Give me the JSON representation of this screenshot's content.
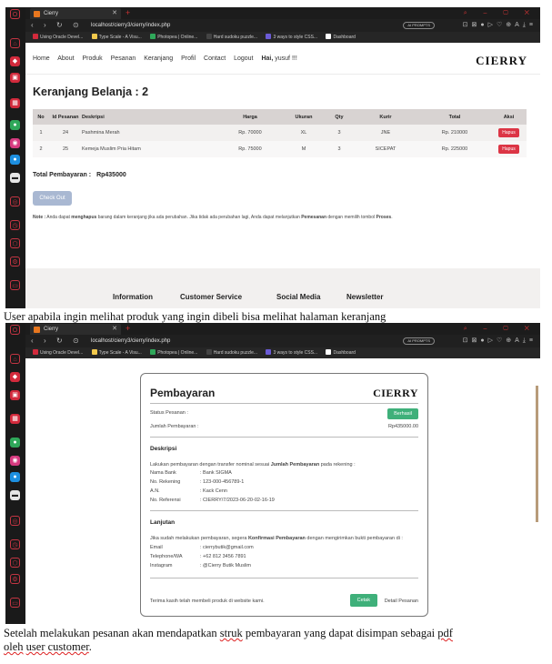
{
  "browser": {
    "tab_title": "Cierry",
    "url": "localhost/cierry3/cierry/index.php",
    "ai_pill": "AI PROMPTS",
    "bookmarks": [
      "Using Oracle Devel...",
      "Type Scale - A Visu...",
      "Photopea | Online...",
      "Hard sudoku puzzle...",
      "3 ways to style CSS...",
      "Dashboard"
    ],
    "bookmark_colors": [
      "#d22a3c",
      "#f2c94c",
      "#2fa85a",
      "#444444",
      "#6b5bd6",
      "#ffffff"
    ]
  },
  "cart_page": {
    "nav": [
      "Home",
      "About",
      "Produk",
      "Pesanan",
      "Keranjang",
      "Profil",
      "Contact",
      "Logout"
    ],
    "greeting": "Hai,",
    "user": "yusuf !!!",
    "brand": "CIERRY",
    "title": "Keranjang Belanja : 2",
    "columns": [
      "No",
      "Id Pesanan",
      "Deskripsi",
      "Harga",
      "Ukuran",
      "Qty",
      "Kurir",
      "Total",
      "Aksi"
    ],
    "rows": [
      [
        "1",
        "24",
        "Pashmina Merah",
        "Rp. 70000",
        "XL",
        "3",
        "JNE",
        "Rp. 210000",
        "Hapus"
      ],
      [
        "2",
        "25",
        "Kemeja Muslim Pria Hitam",
        "Rp. 75000",
        "M",
        "3",
        "SICEPAT",
        "Rp. 225000",
        "Hapus"
      ]
    ],
    "total_label": "Total Pembayaran :",
    "total_value": "Rp435000",
    "checkout": "Check Out",
    "note_label": "Note :",
    "note_text_1": " Anda dapat ",
    "note_bold_1": "menghapus",
    "note_text_2": " barang dalam keranjang jika ada perubahan. Jika tidak ada perubahan lagi, Anda dapat melanjutkan ",
    "note_bold_2": "Pemesanan",
    "note_text_3": " dengan memilih tombol ",
    "note_bold_3": "Proses",
    "note_text_4": ".",
    "footer_links": [
      "Information",
      "Customer Service",
      "Social Media",
      "Newsletter"
    ]
  },
  "caption1": "User apabila ingin melihat produk yang ingin dibeli bisa melihat halaman keranjang",
  "receipt": {
    "title": "Pembayaran",
    "brand": "CIERRY",
    "status_label": "Status Pesanan :",
    "status_value": "Berhasil",
    "amount_label": "Jumlah Pembayaran :",
    "amount_value": "Rp435000.00",
    "desc_head": "Deskripsi",
    "desc_text_1": "Lakukan pembayaran dengan transfer nominal sesuai ",
    "desc_bold": "Jumlah Pembayaran",
    "desc_text_2": " pada rekening :",
    "bank_rows": [
      [
        "Nama Bank",
        ": Bank SIGMA"
      ],
      [
        "No. Rekening",
        ": 123-000-456789-1"
      ],
      [
        "A.N.",
        ": Kack Cenn"
      ],
      [
        "No. Referensi",
        ": CIERRY/7/2023-06-20-02-16-19"
      ]
    ],
    "next_head": "Lanjutan",
    "next_text_1": "Jika sudah melakukan pembayaran, segera ",
    "next_bold": "Konfirmasi Pembayaran",
    "next_text_2": " dengan mengirimkan bukti pembayaran di :",
    "contact_rows": [
      [
        "Email",
        ": cierrybutik@gmail.com"
      ],
      [
        "Telephone/WA",
        ": +62 812 3456 7891"
      ],
      [
        "Instagram",
        ": @Cierry Butik Muslim"
      ]
    ],
    "thanks": "Terima kasih telah membeli produk di website kami.",
    "print": "Cetak",
    "detail": "Detail Pesanan"
  },
  "caption2_a": "Setelah melakukan pesanan akan mendapatkan ",
  "caption2_b": "struk",
  "caption2_c": " pembayaran yang dapat disimpan sebagai ",
  "caption2_d": "pdf",
  "caption2_e": " ",
  "caption2_f": "oleh",
  "caption2_g": " ",
  "caption2_h": "user customer",
  "caption2_i": "."
}
